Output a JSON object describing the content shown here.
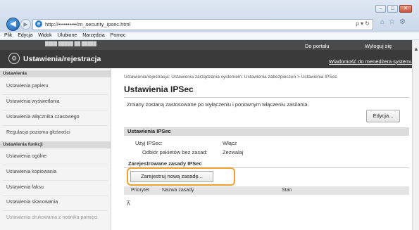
{
  "browser": {
    "url": "http://••••••••••/m_security_ipsec.html",
    "addr_right": "ρ ▾ ↻",
    "menu": [
      "Plik",
      "Edycja",
      "Widok",
      "Ulubione",
      "Narzędzia",
      "Pomoc"
    ],
    "window_buttons": [
      "–",
      "□",
      "✕"
    ]
  },
  "header": {
    "portal_link": "Do portalu",
    "logout_link": "Wyloguj się",
    "app_title": "Ustawienia/rejestracja",
    "manager_message": "Wiadomość do menedżera systemu"
  },
  "sidebar": {
    "section1": "Ustawienia",
    "items1": [
      "Ustawienia papieru",
      "Ustawienia wyświetlania",
      "Ustawienia włącznika czasowego",
      "Regulacja poziomu głośności"
    ],
    "section2": "Ustawienia funkcji",
    "items2": [
      "Ustawienia ogólne",
      "Ustawienia kopiowania",
      "Ustawienia faksu",
      "Ustawienia skanowania",
      "Ustawienia drukowania z nośnika pamięci"
    ]
  },
  "main": {
    "breadcrumb": "Ustawienia/rejestracja: Ustawienia zarządzania systemem: Ustawienia zabezpieczeń > Ustawienia IPSec",
    "title": "Ustawienia IPSec",
    "notice": "Zmiany zostaną zastosowane po wyłączeniu i ponownym włączeniu zasilania.",
    "edit_button": "Edycja...",
    "section_title": "Ustawienia IPSec",
    "use_ipsec_label": "Użyj IPSec:",
    "use_ipsec_value": "Włącz",
    "receive_label": "Odbiór pakietów bez zasad:",
    "receive_value": "Zezwalaj",
    "policies_title": "Zarejestrowane zasady IPSec",
    "register_button": "Zarejestruj nową zasadę...",
    "columns": [
      "Priorytet",
      "Nazwa zasady",
      "Stan"
    ]
  },
  "colors": {
    "highlight": "#f0a030",
    "header_bg": "#3a3a3a"
  }
}
